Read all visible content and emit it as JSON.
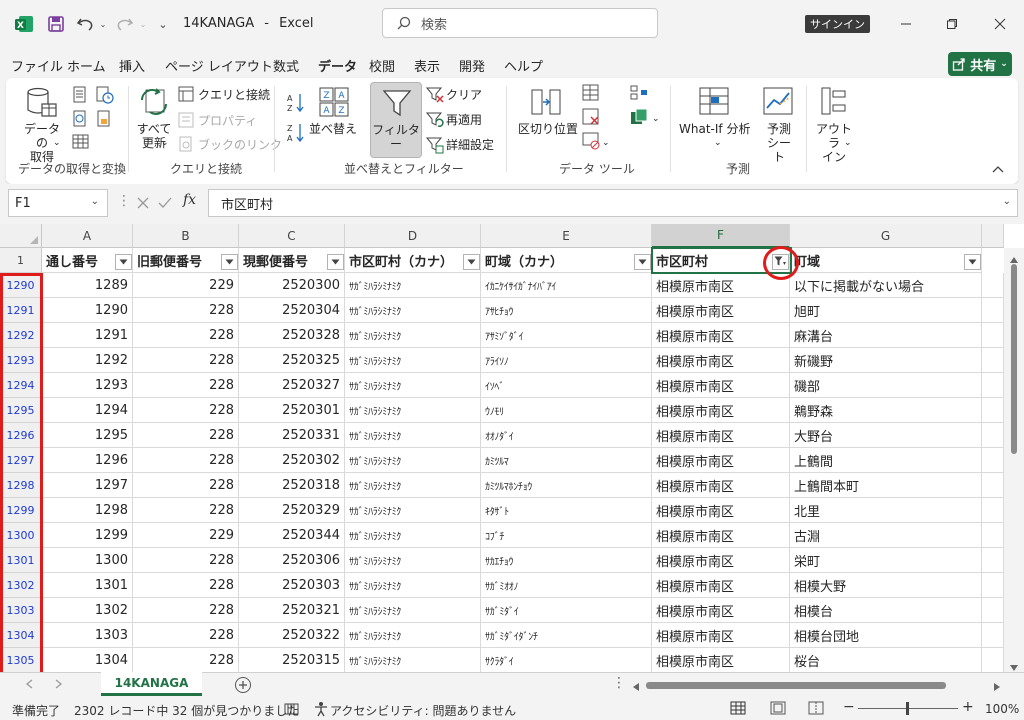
{
  "title": {
    "filename": "14KANAGA",
    "separator": "-",
    "app": "Excel",
    "search_placeholder": "検索",
    "signin": "サインイン"
  },
  "menu": [
    "ファイル",
    "ホーム",
    "挿入",
    "ページ レイアウト",
    "数式",
    "データ",
    "校閲",
    "表示",
    "開発",
    "ヘルプ"
  ],
  "share_label": "共有",
  "ribbon": {
    "get_data": "データの\n取得",
    "group_get": "データの取得と変換",
    "refresh_all": "すべて\n更新",
    "queries": "クエリと接続",
    "properties": "プロパティ",
    "workbook_links": "ブックのリンク",
    "group_queries": "クエリと接続",
    "sort": "並べ替え",
    "filter": "フィルター",
    "clear": "クリア",
    "reapply": "再適用",
    "advanced": "詳細設定",
    "group_sort": "並べ替えとフィルター",
    "text_to_columns": "区切り位置",
    "group_tools": "データ ツール",
    "whatif": "What-If 分析",
    "forecast_sheet": "予測\nシート",
    "group_forecast": "予測",
    "outline": "アウトラ\nイン"
  },
  "formula": {
    "namebox": "F1",
    "content": "市区町村"
  },
  "columns": [
    "A",
    "B",
    "C",
    "D",
    "E",
    "F",
    "G"
  ],
  "headers": [
    "通し番号",
    "旧郵便番号",
    "現郵便番号",
    "市区町村（カナ）",
    "町域（カナ）",
    "市区町村",
    "町域"
  ],
  "rows": [
    {
      "rn": "1290",
      "a": "1289",
      "b": "229",
      "c": "2520300",
      "d": "ｻｶﾞﾐﾊﾗｼﾐﾅﾐｸ",
      "e": "ｲｶﾆｹｲｻｲｶﾞﾅｲﾊﾞｱｲ",
      "f": "相模原市南区",
      "g": "以下に掲載がない場合"
    },
    {
      "rn": "1291",
      "a": "1290",
      "b": "228",
      "c": "2520304",
      "d": "ｻｶﾞﾐﾊﾗｼﾐﾅﾐｸ",
      "e": "ｱｻﾋﾁｮｳ",
      "f": "相模原市南区",
      "g": "旭町"
    },
    {
      "rn": "1292",
      "a": "1291",
      "b": "228",
      "c": "2520328",
      "d": "ｻｶﾞﾐﾊﾗｼﾐﾅﾐｸ",
      "e": "ｱｻﾐｿﾞﾀﾞｲ",
      "f": "相模原市南区",
      "g": "麻溝台"
    },
    {
      "rn": "1293",
      "a": "1292",
      "b": "228",
      "c": "2520325",
      "d": "ｻｶﾞﾐﾊﾗｼﾐﾅﾐｸ",
      "e": "ｱﾗｲｿﾉ",
      "f": "相模原市南区",
      "g": "新磯野"
    },
    {
      "rn": "1294",
      "a": "1293",
      "b": "228",
      "c": "2520327",
      "d": "ｻｶﾞﾐﾊﾗｼﾐﾅﾐｸ",
      "e": "ｲｿﾍﾞ",
      "f": "相模原市南区",
      "g": "磯部"
    },
    {
      "rn": "1295",
      "a": "1294",
      "b": "228",
      "c": "2520301",
      "d": "ｻｶﾞﾐﾊﾗｼﾐﾅﾐｸ",
      "e": "ｳﾉﾓﾘ",
      "f": "相模原市南区",
      "g": "鵜野森"
    },
    {
      "rn": "1296",
      "a": "1295",
      "b": "228",
      "c": "2520331",
      "d": "ｻｶﾞﾐﾊﾗｼﾐﾅﾐｸ",
      "e": "ｵｵﾉﾀﾞｲ",
      "f": "相模原市南区",
      "g": "大野台"
    },
    {
      "rn": "1297",
      "a": "1296",
      "b": "228",
      "c": "2520302",
      "d": "ｻｶﾞﾐﾊﾗｼﾐﾅﾐｸ",
      "e": "ｶﾐﾂﾙﾏ",
      "f": "相模原市南区",
      "g": "上鶴間"
    },
    {
      "rn": "1298",
      "a": "1297",
      "b": "228",
      "c": "2520318",
      "d": "ｻｶﾞﾐﾊﾗｼﾐﾅﾐｸ",
      "e": "ｶﾐﾂﾙﾏﾎﾝﾁｮｳ",
      "f": "相模原市南区",
      "g": "上鶴間本町"
    },
    {
      "rn": "1299",
      "a": "1298",
      "b": "228",
      "c": "2520329",
      "d": "ｻｶﾞﾐﾊﾗｼﾐﾅﾐｸ",
      "e": "ｷﾀｻﾞﾄ",
      "f": "相模原市南区",
      "g": "北里"
    },
    {
      "rn": "1300",
      "a": "1299",
      "b": "229",
      "c": "2520344",
      "d": "ｻｶﾞﾐﾊﾗｼﾐﾅﾐｸ",
      "e": "ｺﾌﾞﾁ",
      "f": "相模原市南区",
      "g": "古淵"
    },
    {
      "rn": "1301",
      "a": "1300",
      "b": "228",
      "c": "2520306",
      "d": "ｻｶﾞﾐﾊﾗｼﾐﾅﾐｸ",
      "e": "ｻｶｴﾁｮｳ",
      "f": "相模原市南区",
      "g": "栄町"
    },
    {
      "rn": "1302",
      "a": "1301",
      "b": "228",
      "c": "2520303",
      "d": "ｻｶﾞﾐﾊﾗｼﾐﾅﾐｸ",
      "e": "ｻｶﾞﾐｵｵﾉ",
      "f": "相模原市南区",
      "g": "相模大野"
    },
    {
      "rn": "1303",
      "a": "1302",
      "b": "228",
      "c": "2520321",
      "d": "ｻｶﾞﾐﾊﾗｼﾐﾅﾐｸ",
      "e": "ｻｶﾞﾐﾀﾞｲ",
      "f": "相模原市南区",
      "g": "相模台"
    },
    {
      "rn": "1304",
      "a": "1303",
      "b": "228",
      "c": "2520322",
      "d": "ｻｶﾞﾐﾊﾗｼﾐﾅﾐｸ",
      "e": "ｻｶﾞﾐﾀﾞｲﾀﾞﾝﾁ",
      "f": "相模原市南区",
      "g": "相模台団地"
    },
    {
      "rn": "1305",
      "a": "1304",
      "b": "228",
      "c": "2520315",
      "d": "ｻｶﾞﾐﾊﾗｼﾐﾅﾐｸ",
      "e": "ｻｸﾗﾀﾞｲ",
      "f": "相模原市南区",
      "g": "桜台"
    }
  ],
  "sheet_tab": "14KANAGA",
  "status": {
    "ready": "準備完了",
    "found": "2302 レコード中 32 個が見つかりました",
    "accessibility": "アクセシビリティ: 問題ありません",
    "zoom": "100%"
  }
}
